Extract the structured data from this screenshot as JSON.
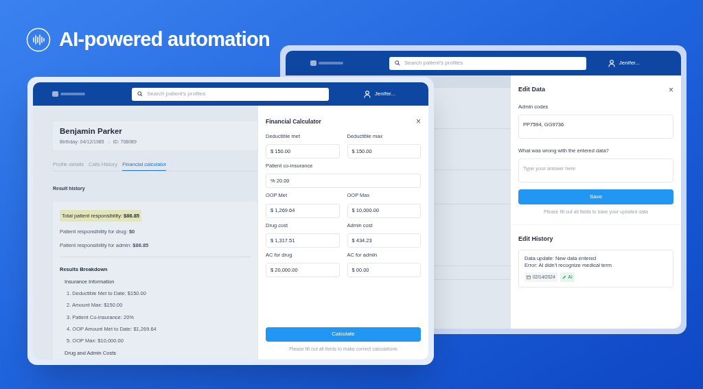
{
  "headline": {
    "text": "AI-powered automation"
  },
  "back_window": {
    "search": {
      "placeholder": "Search patient's profiles"
    },
    "user": "Jenifer...",
    "edit_panel": {
      "title": "Edit Data",
      "close": "×",
      "fields": [
        {
          "label": "Admin codes",
          "value": "PP7594, GG9736"
        },
        {
          "label": "What was wrong with the entered data?",
          "placeholder": "Type your answer here"
        }
      ],
      "button": "Save",
      "hint": "Please fill out all fields to save your updated data",
      "history_title": "Edit History",
      "history": [
        {
          "lines": [
            "Data update: New data entered",
            "Error: AI didn't recognize medical term"
          ],
          "date": "02/14/2024",
          "author": "AI"
        }
      ]
    }
  },
  "front_window": {
    "search": {
      "placeholder": "Search patient's profiles"
    },
    "user": "Jenifer...",
    "patient": {
      "name": "Benjamin Parker",
      "birthday": "Birthday: 04/12/1985",
      "id": "ID: 708089"
    },
    "tabs": [
      {
        "label": "Profile details",
        "selected": false
      },
      {
        "label": "Calls History",
        "selected": false
      },
      {
        "label": "Financial calculator",
        "selected": true
      }
    ],
    "section_title": "Result history",
    "results": {
      "total": "Total patient responsibility: **$86.85**",
      "lines": [
        "Patient responsibility for drug: **$0**",
        "Patient responsibility for admin: **$86.85**"
      ],
      "breakdown_title": "Results Breakdown",
      "groups": [
        {
          "title": "Insurance Information",
          "items": [
            "1. Deductible Met to Date: $150.00",
            "2. Amount Max: $150.00",
            "3. Patient Co-Insurance: 20%",
            "4. OOP Amount Met to Date: $1,269.64",
            "5. OOP Max: $10,000.00"
          ]
        },
        {
          "title": "Drug and Admin Costs"
        }
      ]
    },
    "calculator": {
      "title": "Financial Calculator",
      "close": "×",
      "fields": [
        {
          "label": "Deductible met",
          "value": "$ 150.00",
          "kind": "half"
        },
        {
          "label": "Deductible max",
          "value": "$ 150.00",
          "kind": "half"
        },
        {
          "label": "Patient co-insurance",
          "value": "% 20.00",
          "kind": "full"
        },
        {
          "label": "OOP Met",
          "value": "$ 1,269.64",
          "kind": "half"
        },
        {
          "label": "OOP Max",
          "value": "$ 10,000.00",
          "kind": "half"
        },
        {
          "label": "Drug cost",
          "value": "$ 1,317.51",
          "kind": "half"
        },
        {
          "label": "Admin cost",
          "value": "$ 434.23",
          "kind": "half"
        },
        {
          "label": "AC for drug",
          "value": "$ 20,000.00",
          "kind": "half"
        },
        {
          "label": "AC for admin",
          "value": "$ 00.00",
          "kind": "half"
        }
      ],
      "button": "Calculate",
      "hint": "Please fill out all fields to make correct calculations"
    }
  }
}
